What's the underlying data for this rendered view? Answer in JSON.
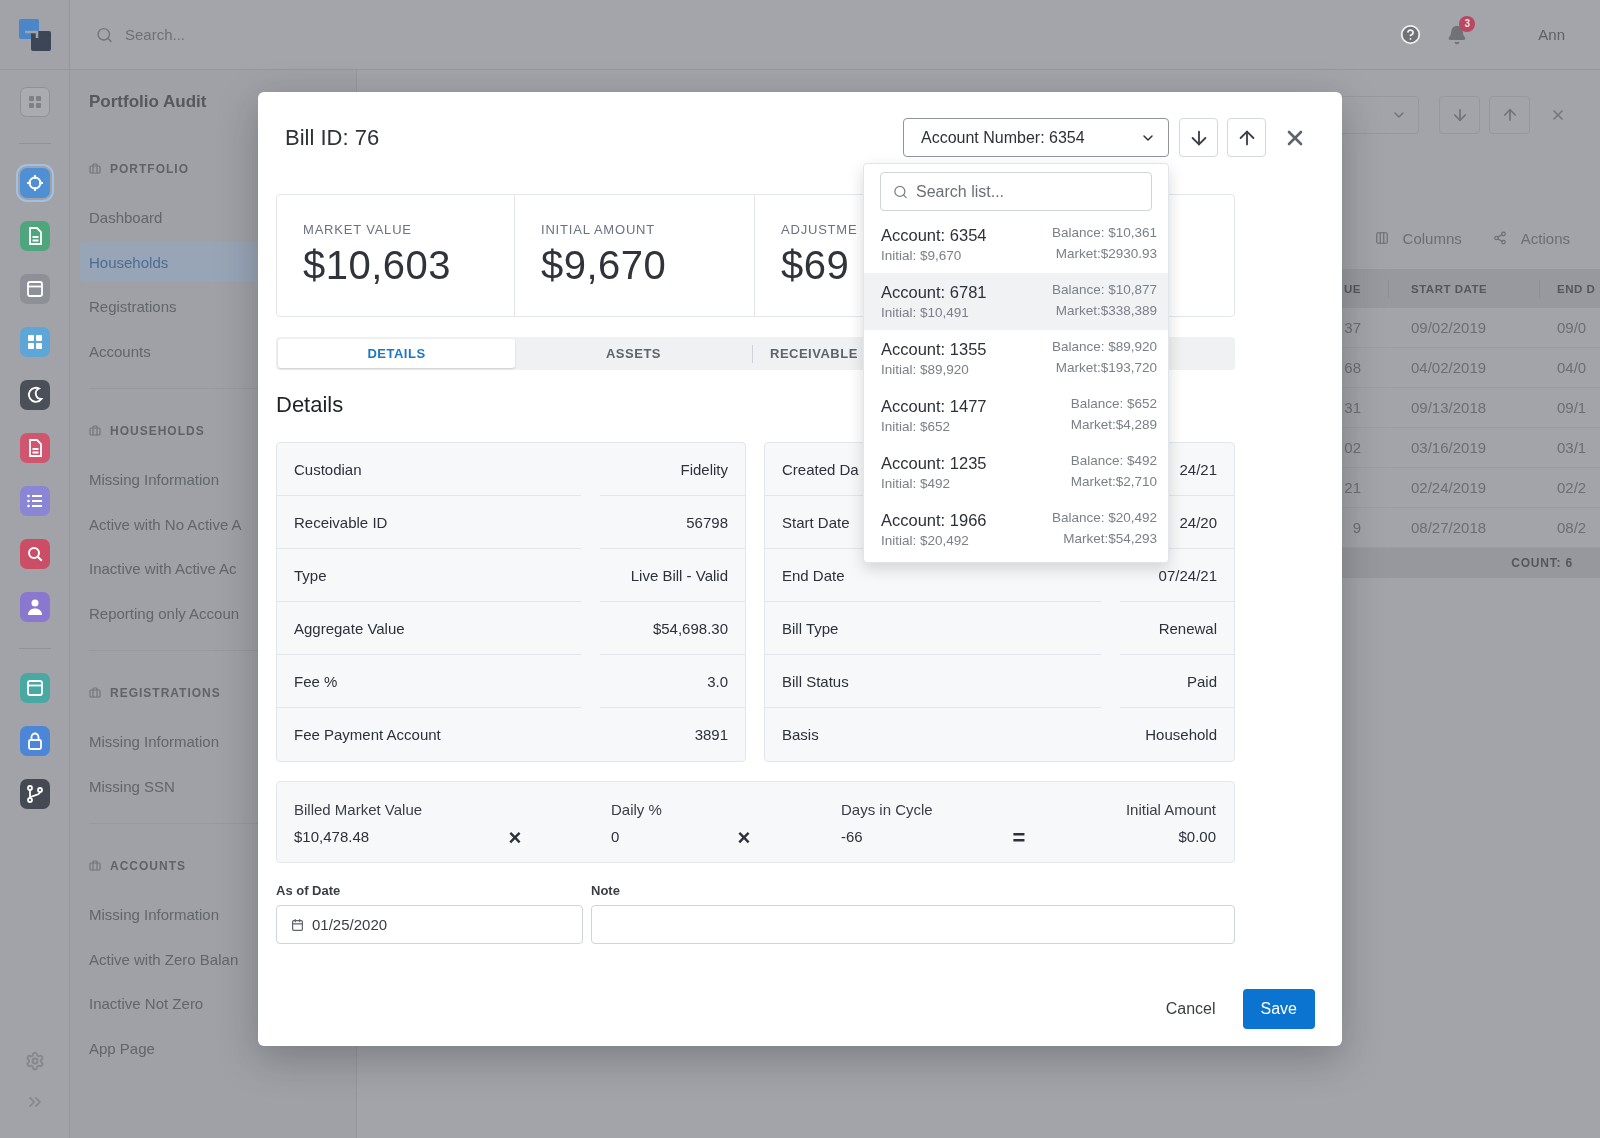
{
  "rail": {
    "apps": [
      {
        "kind": "target",
        "color": "#4f8fd4",
        "selected": true
      },
      {
        "kind": "document",
        "color": "#4fa57c",
        "selected": false
      },
      {
        "kind": "window",
        "color": "#8d9096",
        "selected": false
      },
      {
        "kind": "grid",
        "color": "#5fa6d8",
        "selected": false
      },
      {
        "kind": "moon",
        "color": "#4b4f57",
        "selected": false
      },
      {
        "kind": "document",
        "color": "#d0566f",
        "selected": false
      },
      {
        "kind": "list",
        "color": "#8b85d6",
        "selected": false
      },
      {
        "kind": "search",
        "color": "#cc4d66",
        "selected": false
      },
      {
        "kind": "user",
        "color": "#8a78cf",
        "selected": false
      }
    ],
    "tools": [
      {
        "kind": "window",
        "color": "#4aa8a2",
        "selected": false
      },
      {
        "kind": "lock",
        "color": "#4d86d6",
        "selected": false
      },
      {
        "kind": "branch",
        "color": "#454a52",
        "selected": false
      }
    ]
  },
  "top_bar": {
    "search": {
      "placeholder": "Search..."
    },
    "notifications": {
      "badge": "3"
    },
    "user": "Ann"
  },
  "sidebar": {
    "title": "Portfolio Audit",
    "sections": [
      {
        "title": "PORTFOLIO",
        "items": [
          {
            "label": "Dashboard",
            "selected": false
          },
          {
            "label": "Households",
            "selected": true
          },
          {
            "label": "Registrations",
            "selected": false
          },
          {
            "label": "Accounts",
            "selected": false
          }
        ]
      },
      {
        "title": "HOUSEHOLDS",
        "items": [
          {
            "label": "Missing Information",
            "selected": false
          },
          {
            "label": "Active with No Active A",
            "selected": false
          },
          {
            "label": "Inactive with Active Ac",
            "selected": false
          },
          {
            "label": "Reporting only Accoun",
            "selected": false
          }
        ]
      },
      {
        "title": "REGISTRATIONS",
        "items": [
          {
            "label": "Missing Information",
            "selected": false
          },
          {
            "label": "Missing SSN",
            "selected": false
          }
        ]
      },
      {
        "title": "ACCOUNTS",
        "items": [
          {
            "label": "Missing Information",
            "selected": false
          },
          {
            "label": "Active with Zero Balan",
            "selected": false
          },
          {
            "label": "Inactive Not Zero",
            "selected": false
          },
          {
            "label": "App Page",
            "selected": false
          }
        ]
      }
    ]
  },
  "main": {
    "toolbar": [
      {
        "label": "Columns",
        "kind": "columns"
      },
      {
        "label": "Actions",
        "kind": "share"
      }
    ],
    "table": {
      "columns": [
        "UE",
        "START DATE",
        "END D"
      ],
      "rows": [
        [
          "37",
          "09/02/2019",
          "09/0"
        ],
        [
          "68",
          "04/02/2019",
          "04/0"
        ],
        [
          "31",
          "09/13/2018",
          "09/1"
        ],
        [
          "02",
          "03/16/2019",
          "03/1"
        ],
        [
          "21",
          "02/24/2019",
          "02/2"
        ],
        [
          "9",
          "08/27/2018",
          "08/2"
        ]
      ],
      "footer": "COUNT: 6"
    }
  },
  "modal": {
    "title": "Bill ID: 76",
    "account_select": {
      "value": "Account Number: 6354",
      "expanded": true
    },
    "dropdown": {
      "search": {
        "placeholder": "Search list..."
      },
      "items": [
        {
          "account": "Account: 6354",
          "initial": "Initial: $9,670",
          "balance": "Balance: $10,361",
          "market": "Market:$2930.93",
          "highlighted": false
        },
        {
          "account": "Account: 6781",
          "initial": "Initial: $10,491",
          "balance": "Balance: $10,877",
          "market": "Market:$338,389",
          "highlighted": true
        },
        {
          "account": "Account: 1355",
          "initial": "Initial: $89,920",
          "balance": "Balance: $89,920",
          "market": "Market:$193,720",
          "highlighted": false
        },
        {
          "account": "Account: 1477",
          "initial": "Initial: $652",
          "balance": "Balance: $652",
          "market": "Market:$4,289",
          "highlighted": false
        },
        {
          "account": "Account: 1235",
          "initial": "Initial: $492",
          "balance": "Balance: $492",
          "market": "Market:$2,710",
          "highlighted": false
        },
        {
          "account": "Account: 1966",
          "initial": "Initial: $20,492",
          "balance": "Balance: $20,492",
          "market": "Market:$54,293",
          "highlighted": false
        }
      ]
    },
    "stats": [
      {
        "label": "MARKET VALUE",
        "value": "$10,603"
      },
      {
        "label": "INITIAL AMOUNT",
        "value": "$9,670"
      },
      {
        "label": "ADJUSTME",
        "value": "$69"
      }
    ],
    "tabs": [
      {
        "label": "DETAILS",
        "selected": true
      },
      {
        "label": "ASSETS",
        "selected": false
      },
      {
        "label": "RECEIVABLE",
        "selected": false
      }
    ],
    "section_title": "Details",
    "details": [
      [
        {
          "label": "Custodian",
          "value": "Fidelity"
        },
        {
          "label": "Receivable ID",
          "value": "56798"
        },
        {
          "label": "Type",
          "value": "Live Bill - Valid"
        },
        {
          "label": "Aggregate Value",
          "value": "$54,698.30"
        },
        {
          "label": "Fee %",
          "value": "3.0"
        },
        {
          "label": "Fee Payment Account",
          "value": "3891"
        }
      ],
      [
        {
          "label": "Created Da",
          "value": "24/21"
        },
        {
          "label": "Start Date",
          "value": "24/20"
        },
        {
          "label": "End Date",
          "value": "07/24/21"
        },
        {
          "label": "Bill Type",
          "value": "Renewal"
        },
        {
          "label": "Bill Status",
          "value": "Paid"
        },
        {
          "label": "Basis",
          "value": "Household"
        }
      ]
    ],
    "formula": {
      "terms": [
        {
          "label": "Billed Market Value",
          "value": "$10,478.48"
        },
        {
          "label": "Daily %",
          "value": "0"
        },
        {
          "label": "Days in Cycle",
          "value": "-66"
        },
        {
          "label": "Initial Amount",
          "value": "$0.00"
        }
      ],
      "operators": [
        "×",
        "×",
        "="
      ]
    },
    "as_of_date": {
      "label": "As of Date",
      "value": "01/25/2020"
    },
    "note": {
      "label": "Note"
    },
    "buttons": [
      {
        "label": "Cancel",
        "kind": "secondary"
      },
      {
        "label": "Save",
        "kind": "primary"
      }
    ]
  }
}
